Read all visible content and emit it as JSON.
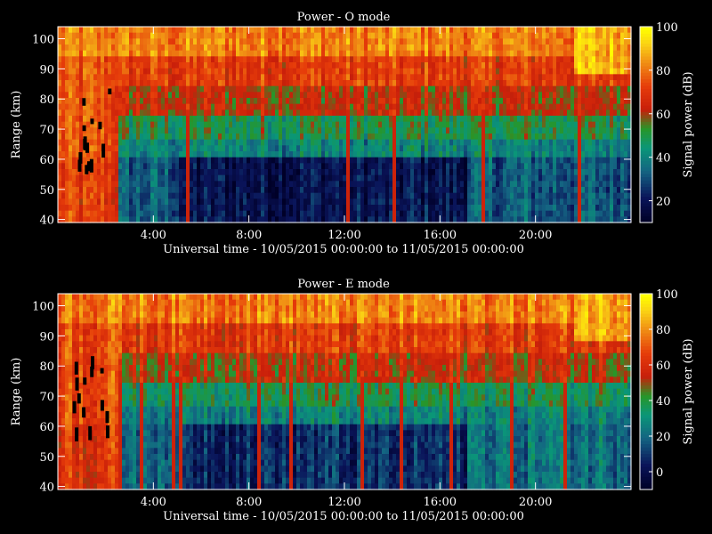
{
  "chart_data": [
    {
      "type": "heatmap",
      "title": "Power - O mode",
      "xlabel": "Universal time - 10/05/2015 00:00:00 to 11/05/2015 00:00:00",
      "ylabel": "Range (km)",
      "x_ticks": [
        "4:00",
        "8:00",
        "12:00",
        "16:00",
        "20:00"
      ],
      "x_tick_hours": [
        4,
        8,
        12,
        16,
        20
      ],
      "xlim_hours": [
        0,
        24
      ],
      "y_ticks": [
        40,
        50,
        60,
        70,
        80,
        90,
        100
      ],
      "ylim": [
        39,
        104
      ],
      "colorbar": {
        "label": "Signal power (dB)",
        "ticks": [
          20,
          40,
          60,
          80,
          100
        ],
        "range": [
          10,
          100
        ]
      }
    },
    {
      "type": "heatmap",
      "title": "Power - E mode",
      "xlabel": "Universal time - 10/05/2015 00:00:00 to 11/05/2015 00:00:00",
      "ylabel": "Range (km)",
      "x_ticks": [
        "4:00",
        "8:00",
        "12:00",
        "16:00",
        "20:00"
      ],
      "x_tick_hours": [
        4,
        8,
        12,
        16,
        20
      ],
      "xlim_hours": [
        0,
        24
      ],
      "y_ticks": [
        40,
        50,
        60,
        70,
        80,
        90,
        100
      ],
      "ylim": [
        39,
        104
      ],
      "colorbar": {
        "label": "Signal power (dB)",
        "ticks": [
          0,
          20,
          40,
          60,
          80,
          100
        ],
        "range": [
          -10,
          100
        ]
      }
    }
  ]
}
